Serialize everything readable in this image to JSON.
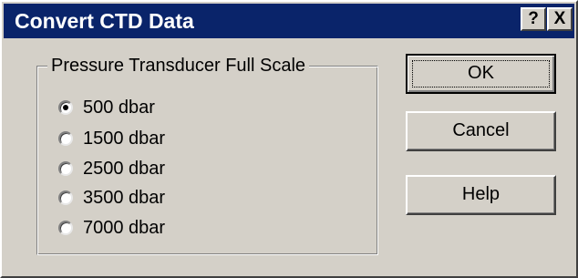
{
  "window": {
    "title": "Convert CTD Data",
    "help_button": "?",
    "close_button": "X"
  },
  "group": {
    "label": "Pressure Transducer Full Scale",
    "options": [
      {
        "label": "500 dbar",
        "selected": true
      },
      {
        "label": "1500 dbar",
        "selected": false
      },
      {
        "label": "2500 dbar",
        "selected": false
      },
      {
        "label": "3500 dbar",
        "selected": false
      },
      {
        "label": "7000 dbar",
        "selected": false
      }
    ]
  },
  "buttons": {
    "ok": "OK",
    "cancel": "Cancel",
    "help": "Help"
  }
}
